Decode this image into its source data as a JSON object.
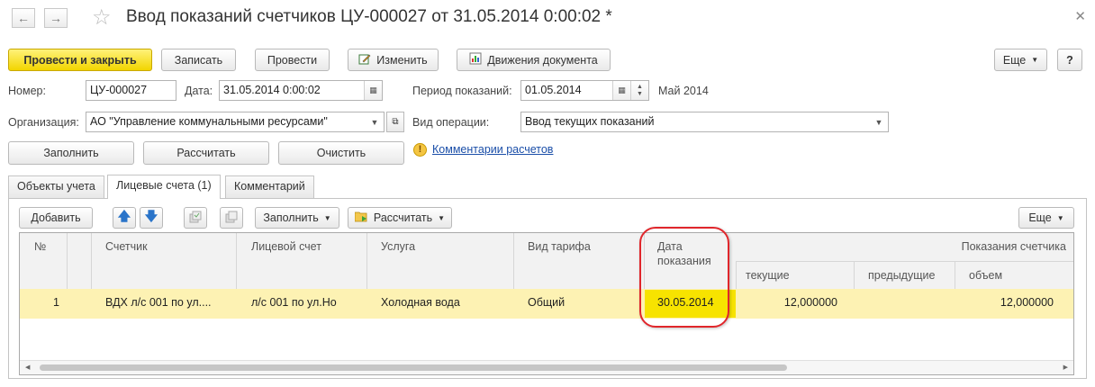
{
  "window": {
    "title": "Ввод показаний счетчиков ЦУ-000027 от 31.05.2014 0:00:02 *"
  },
  "toolbar": {
    "post_and_close": "Провести и закрыть",
    "write": "Записать",
    "post": "Провести",
    "edit": "Изменить",
    "movements": "Движения документа",
    "more": "Еще",
    "help": "?"
  },
  "form": {
    "number_label": "Номер:",
    "number_value": "ЦУ-000027",
    "date_label": "Дата:",
    "date_value": "31.05.2014  0:00:02",
    "period_label": "Период показаний:",
    "period_value": "01.05.2014",
    "period_text": "Май 2014",
    "org_label": "Организация:",
    "org_value": "АО \"Управление коммунальными ресурсами\"",
    "operation_label": "Вид операции:",
    "operation_value": "Ввод текущих показаний"
  },
  "actions": {
    "fill": "Заполнить",
    "calculate": "Рассчитать",
    "clear": "Очистить",
    "comments_link": "Комментарии расчетов"
  },
  "tabs": [
    {
      "label": "Объекты учета"
    },
    {
      "label": "Лицевые счета (1)"
    },
    {
      "label": "Комментарий"
    }
  ],
  "table_toolbar": {
    "add": "Добавить",
    "fill": "Заполнить",
    "calculate": "Рассчитать",
    "more": "Еще"
  },
  "table": {
    "columns": {
      "num": "№",
      "meter": "Счетчик",
      "account": "Лицевой счет",
      "service": "Услуга",
      "tariff": "Вид тарифа",
      "date_line1": "Дата",
      "date_line2": "показания",
      "readings_group": "Показания счетчика",
      "current": "текущие",
      "previous": "предыдущие",
      "volume": "объем"
    },
    "rows": [
      {
        "num": "1",
        "meter": "ВДХ л/с 001 по ул....",
        "account": "л/с 001 по ул.Но",
        "service": "Холодная вода",
        "tariff": "Общий",
        "date": "30.05.2014",
        "current": "12,000000",
        "previous": "",
        "volume": "12,000000"
      }
    ]
  },
  "colors": {
    "primary_button": "#f2d500",
    "selected_row": "#fdf2b3",
    "highlight_circle": "#e0262b",
    "link": "#1a4ea8"
  }
}
